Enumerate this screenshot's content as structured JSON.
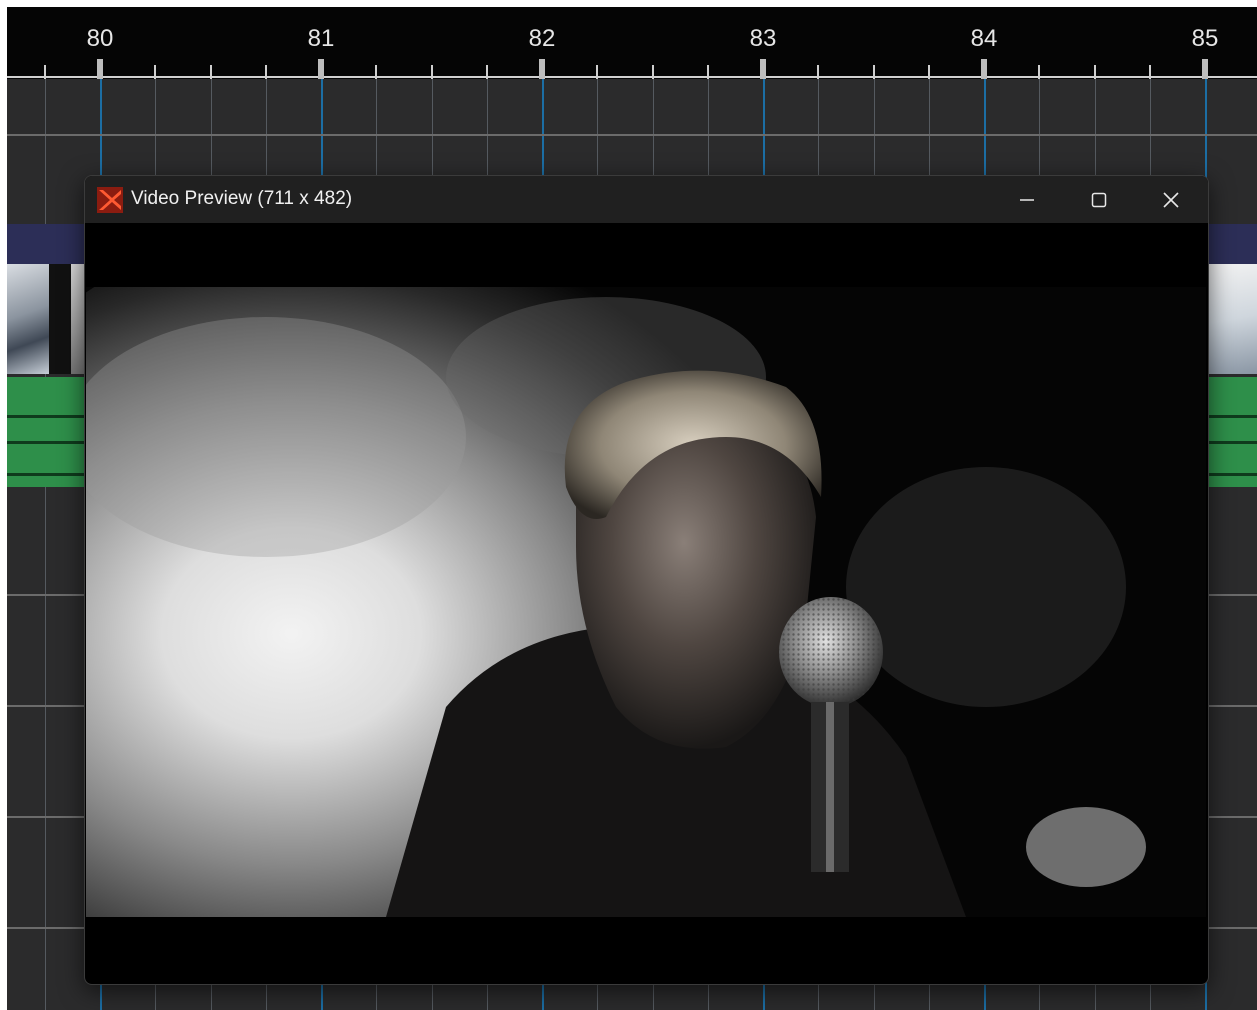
{
  "ruler": {
    "labels": [
      "80",
      "81",
      "82",
      "83",
      "84",
      "85"
    ]
  },
  "preview_window": {
    "title": "Video Preview (711 x 482)",
    "minimize_icon": "minimize-icon",
    "maximize_icon": "maximize-icon",
    "close_icon": "close-icon",
    "app_icon": "app-logo-icon"
  },
  "colors": {
    "ruler_background": "#050505",
    "timeline_background": "#2b2b2c",
    "major_gridline": "#1c6ea4",
    "video_track_band": "#2c2e57",
    "audio_clip": "#2e8f4a",
    "title_bar": "#202020",
    "app_icon_red": "#e0402a"
  }
}
